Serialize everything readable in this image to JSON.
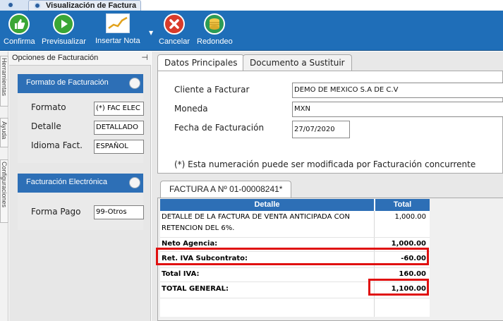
{
  "window": {
    "tab_title": "Visualización de Factura"
  },
  "toolbar": {
    "confirm": "Confirma",
    "preview": "Previsualizar",
    "insert_note": "Insertar Nota",
    "cancel": "Cancelar",
    "round": "Redondeo"
  },
  "side_tabs": [
    "Herramientas",
    "Ayuda",
    "Configuraciones"
  ],
  "left_panel": {
    "title": "Opciones de Facturación",
    "formato_group": {
      "title": "Formato de Facturación",
      "fields": [
        {
          "label": "Formato",
          "value": "(*) FAC ELEC F"
        },
        {
          "label": "Detalle",
          "value": "DETALLADO"
        },
        {
          "label": "Idioma Fact.",
          "value": "ESPAÑOL"
        }
      ]
    },
    "electronica_group": {
      "title": "Facturación Electrónica",
      "fields": [
        {
          "label": "Forma Pago",
          "value": "99-Otros"
        }
      ]
    }
  },
  "main": {
    "tabs": [
      "Datos Principales",
      "Documento a Sustituir"
    ],
    "cliente_label": "Cliente a Facturar",
    "cliente_value": "DEMO DE MEXICO S.A DE C.V",
    "moneda_label": "Moneda",
    "moneda_value": "MXN",
    "fecha_label": "Fecha de Facturación",
    "fecha_value": "27/07/2020",
    "note": "(*) Esta numeración puede ser modificada por Facturación concurrente",
    "factura_tab": "FACTURA A Nº 01-00008241*",
    "table": {
      "col_detalle": "Detalle",
      "col_total": "Total",
      "rows": [
        {
          "detalle_1": "DETALLE DE LA FACTURA DE VENTA ANTICIPADA CON",
          "detalle_2": "RETENCION DEL 6%.",
          "total": "1,000.00"
        },
        {
          "detalle": "Neto Agencia:",
          "total": "1,000.00"
        },
        {
          "detalle": "Ret. IVA Subcontrato:",
          "total": "-60.00"
        },
        {
          "detalle": "Total IVA:",
          "total": "160.00"
        },
        {
          "detalle": "TOTAL GENERAL:",
          "total": "1,100.00"
        }
      ]
    }
  },
  "colors": {
    "toolbar_bg": "#1f6eb8",
    "group_header": "#2d6fb6",
    "highlight": "#e01010"
  }
}
